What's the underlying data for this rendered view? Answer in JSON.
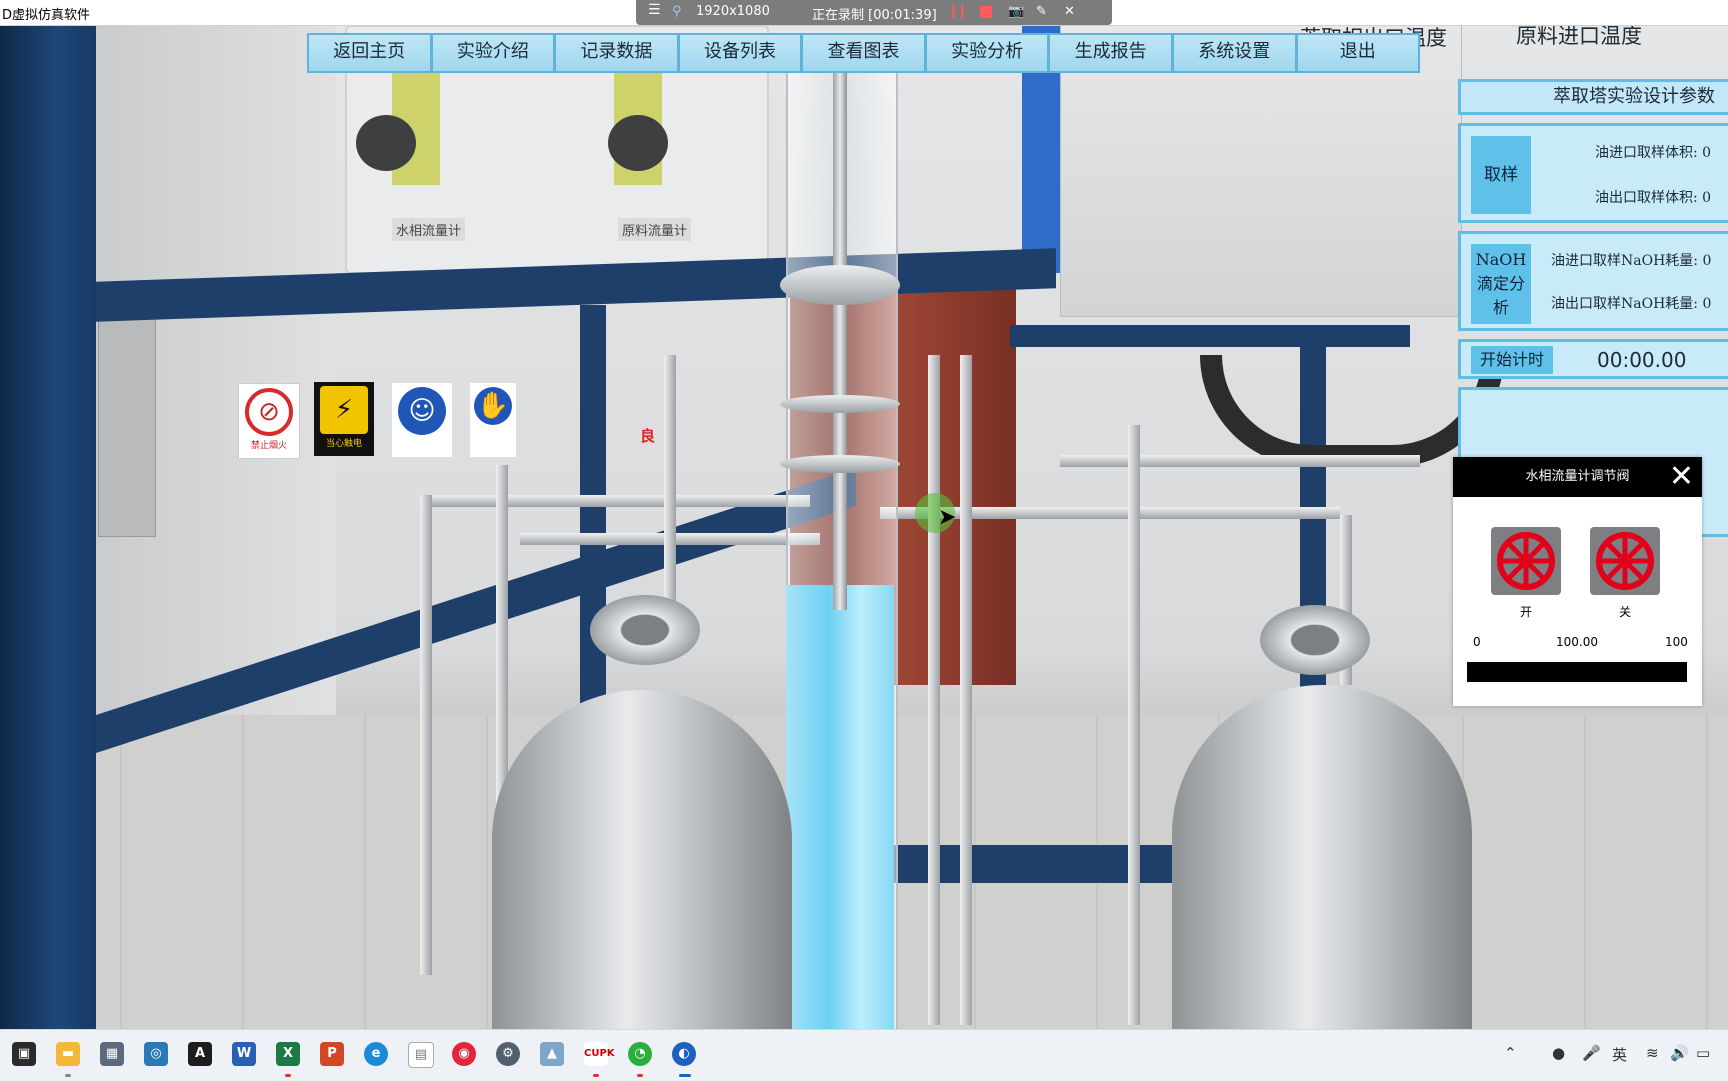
{
  "window": {
    "app_title": "D虚拟仿真软件"
  },
  "recorder": {
    "resolution": "1920x1080",
    "status": "正在录制 [00:01:39]"
  },
  "nav": {
    "items": [
      "返回主页",
      "实验介绍",
      "记录数据",
      "设备列表",
      "查看图表",
      "实验分析",
      "生成报告",
      "系统设置",
      "退出"
    ]
  },
  "header_fragments": {
    "outlet_temp": "萃取相出口温度",
    "inlet_temp": "原料进口温度"
  },
  "scene": {
    "water_flowmeter_label": "水相流量计",
    "feed_flowmeter_label": "原料流量计",
    "sign_no_fire": "禁止烟火",
    "sign_electric": "当心触电",
    "sign_red_text": "良"
  },
  "params": {
    "title": "萃取塔实验设计参数",
    "sampling": {
      "label": "取样",
      "oil_in_volume": "油进口取样体积:  0",
      "oil_out_volume": "油出口取样体积:  0"
    },
    "naoh": {
      "label": "NaOH滴定分析",
      "in_consumption": "油进口取样NaOH耗量:  0",
      "out_consumption": "油出口取样NaOH耗量:  0"
    },
    "timer": {
      "button": "开始计时",
      "value": "00:00.00"
    }
  },
  "valve_popup": {
    "title": "水相流量计调节阀",
    "open_label": "开",
    "close_label": "关",
    "scale_min": "0",
    "scale_value": "100.00",
    "scale_max": "100",
    "progress_fraction": 1.0
  },
  "taskbar": {
    "apps": [
      "task-view",
      "file-explorer",
      "calculator",
      "network",
      "acrobat",
      "word",
      "excel",
      "powerpoint",
      "edge",
      "notepad",
      "netease-music",
      "settings",
      "monitor",
      "cupk",
      "wechat",
      "simulator"
    ],
    "tray_lang": "英"
  },
  "colors": {
    "accent": "#5fb3db",
    "panel": "#c9eaf9",
    "water": "#6fd0f3",
    "valve": "#e3001b"
  }
}
